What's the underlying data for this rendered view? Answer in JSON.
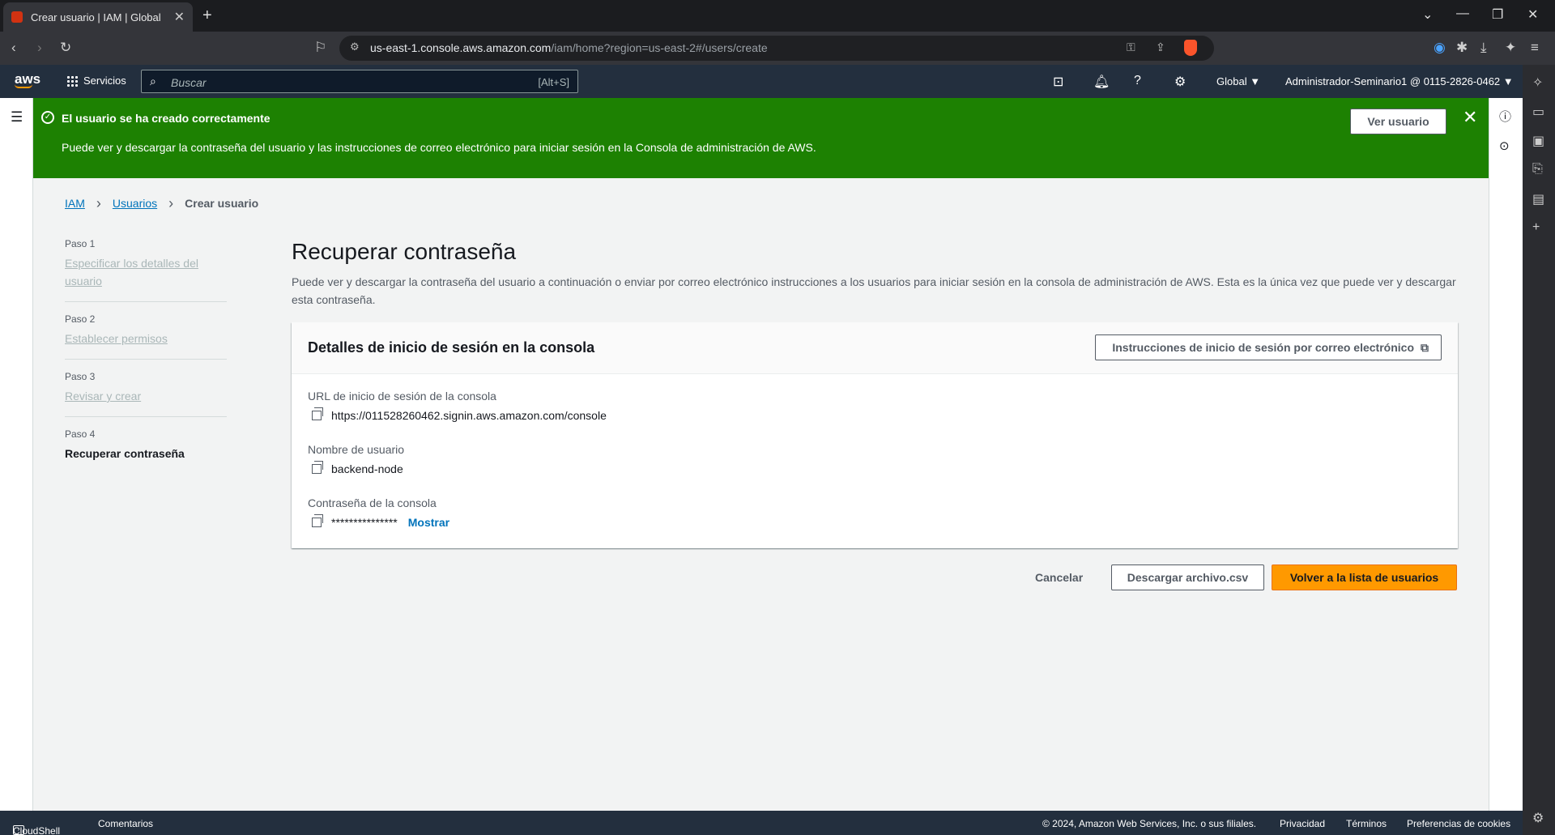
{
  "browser": {
    "tab_title": "Crear usuario | IAM | Global",
    "url_host": "us-east-1.console.aws.amazon.com",
    "url_path": "/iam/home?region=us-east-2#/users/create",
    "new_tab_glyph": "+",
    "close_tab_glyph": "✕",
    "icons": [
      "back-icon",
      "forward-icon",
      "reload-icon",
      "bookmark-icon",
      "site-settings-icon",
      "password-key-icon",
      "share-icon",
      "brave-shield-icon",
      "extensions-icon",
      "download-icon",
      "menu-icon"
    ]
  },
  "awsnav": {
    "logo": "aws",
    "services_label": "Servicios",
    "search_placeholder": "Buscar",
    "search_shortcut": "[Alt+S]",
    "region_label": "Global ▼",
    "account_label": "Administrador-Seminario1 @ 0115-2826-0462 ▼"
  },
  "flash": {
    "title": "El usuario se ha creado correctamente",
    "description": "Puede ver y descargar la contraseña del usuario y las instrucciones de correo electrónico para iniciar sesión en la Consola de administración de AWS.",
    "view_button": "Ver usuario",
    "close_glyph": "✕"
  },
  "breadcrumb": {
    "items": [
      "IAM",
      "Usuarios"
    ],
    "current": "Crear usuario"
  },
  "steps": [
    {
      "num": "Paso 1",
      "label": "Especificar los detalles del usuario"
    },
    {
      "num": "Paso 2",
      "label": "Establecer permisos"
    },
    {
      "num": "Paso 3",
      "label": "Revisar y crear"
    },
    {
      "num": "Paso 4",
      "label": "Recuperar contraseña"
    }
  ],
  "main": {
    "title": "Recuperar contraseña",
    "lead": "Puede ver y descargar la contraseña del usuario a continuación o enviar por correo electrónico instrucciones a los usuarios para iniciar sesión en la consola de administración de AWS. Esta es la única vez que puede ver y descargar esta contraseña."
  },
  "card": {
    "title": "Detalles de inicio de sesión en la consola",
    "email_button": "Instrucciones de inicio de sesión por correo electrónico",
    "url_label": "URL de inicio de sesión de la consola",
    "url_value": "https://011528260462.signin.aws.amazon.com/console",
    "user_label": "Nombre de usuario",
    "user_value": "backend-node",
    "pwd_label": "Contraseña de la consola",
    "pwd_value": "***************",
    "show_label": "Mostrar"
  },
  "actions": {
    "cancel": "Cancelar",
    "download": "Descargar archivo.csv",
    "back": "Volver a la lista de usuarios"
  },
  "footer": {
    "cloudshell": "CloudShell",
    "feedback": "Comentarios",
    "copyright": "© 2024, Amazon Web Services, Inc. o sus filiales.",
    "privacy": "Privacidad",
    "terms": "Términos",
    "cookies": "Preferencias de cookies"
  },
  "colors": {
    "success": "#1d8102",
    "primary": "#ff9900",
    "link": "#0073bb",
    "nav": "#232f3e"
  }
}
